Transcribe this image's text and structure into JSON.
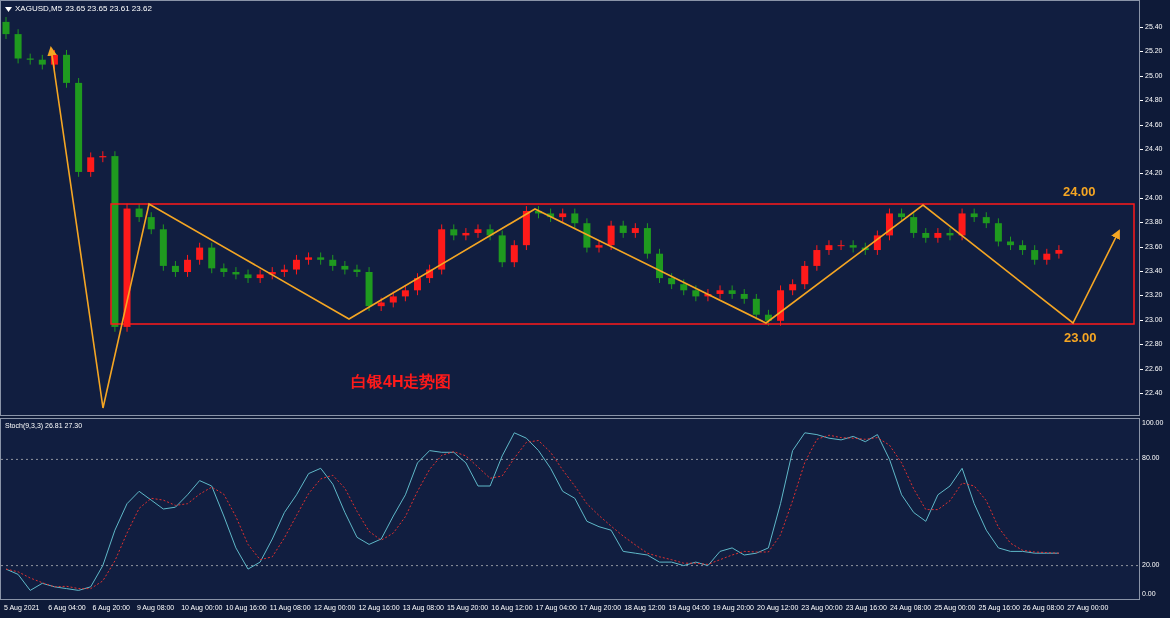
{
  "header": {
    "symbol": "XAGUSD,M5",
    "quotes": "23.65 23.65 23.61 23.62"
  },
  "price_axis": {
    "labels": [
      "25.40",
      "25.20",
      "25.00",
      "24.80",
      "24.60",
      "24.40",
      "24.20",
      "24.00",
      "23.80",
      "23.60",
      "23.40",
      "23.20",
      "23.00",
      "22.80",
      "22.60",
      "22.40"
    ]
  },
  "annotations": [
    {
      "text": "24.00",
      "kind": "level"
    },
    {
      "text": "23.00",
      "kind": "level"
    },
    {
      "text": "白银4H走势图",
      "kind": "caption"
    }
  ],
  "indicator": {
    "legend": "Stoch(9,3,3) 26.81 27.30",
    "axis_labels": [
      "100.00",
      "80.00",
      "20.00",
      "0.00"
    ]
  },
  "time_axis": {
    "labels": [
      "5 Aug 2021",
      "6 Aug 04:00",
      "6 Aug 20:00",
      "9 Aug 08:00",
      "10 Aug 00:00",
      "10 Aug 16:00",
      "11 Aug 08:00",
      "12 Aug 00:00",
      "12 Aug 16:00",
      "13 Aug 08:00",
      "15 Aug 20:00",
      "16 Aug 12:00",
      "17 Aug 04:00",
      "17 Aug 20:00",
      "18 Aug 12:00",
      "19 Aug 04:00",
      "19 Aug 20:00",
      "20 Aug 12:00",
      "23 Aug 00:00",
      "23 Aug 16:00",
      "24 Aug 08:00",
      "25 Aug 00:00",
      "25 Aug 16:00",
      "26 Aug 08:00",
      "27 Aug 00:00"
    ]
  }
}
